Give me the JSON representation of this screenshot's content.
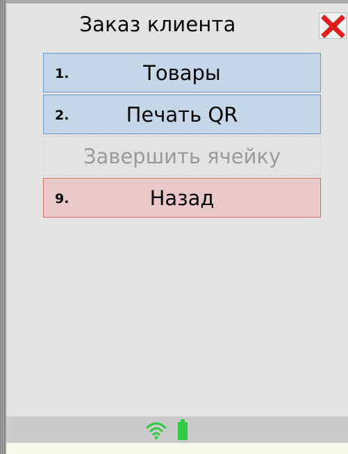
{
  "window": {
    "title": "Заказ клиента"
  },
  "menu": {
    "items": [
      {
        "number": "1.",
        "label": "Товары",
        "state": "enabled",
        "color": "#c5d6e7"
      },
      {
        "number": "2.",
        "label": "Печать QR",
        "state": "enabled",
        "color": "#c5d6e7"
      },
      {
        "number": "",
        "label": "Завершить ячейку",
        "state": "disabled",
        "color": "#e3e3e3"
      },
      {
        "number": "9.",
        "label": "Назад",
        "state": "enabled",
        "color": "#e8c8c8"
      }
    ]
  },
  "status": {
    "wifi_icon": "wifi-icon",
    "battery_icon": "battery-icon",
    "accent_color": "#2ecc40"
  },
  "colors": {
    "close_icon": "#e21b1b"
  }
}
